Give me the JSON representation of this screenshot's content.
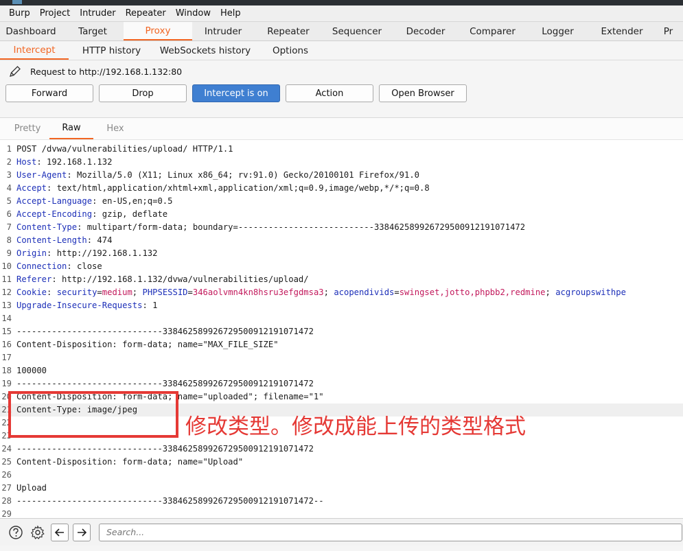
{
  "menubar": [
    "Burp",
    "Project",
    "Intruder",
    "Repeater",
    "Window",
    "Help"
  ],
  "main_tabs": [
    "Dashboard",
    "Target",
    "Proxy",
    "Intruder",
    "Repeater",
    "Sequencer",
    "Decoder",
    "Comparer",
    "Logger",
    "Extender",
    "Pr"
  ],
  "main_tabs_active": "Proxy",
  "proxy_tabs": [
    "Intercept",
    "HTTP history",
    "WebSockets history",
    "Options"
  ],
  "proxy_tabs_active": "Intercept",
  "request_label": "Request to http://192.168.1.132:80",
  "buttons": {
    "forward": "Forward",
    "drop": "Drop",
    "intercept": "Intercept is on",
    "action": "Action",
    "open_browser": "Open Browser"
  },
  "editor_tabs": [
    "Pretty",
    "Raw",
    "Hex"
  ],
  "editor_tabs_active": "Raw",
  "lines": [
    "POST /dvwa/vulnerabilities/upload/ HTTP/1.1",
    "Host: 192.168.1.132",
    "User-Agent: Mozilla/5.0 (X11; Linux x86_64; rv:91.0) Gecko/20100101 Firefox/91.0",
    "Accept: text/html,application/xhtml+xml,application/xml;q=0.9,image/webp,*/*;q=0.8",
    "Accept-Language: en-US,en;q=0.5",
    "Accept-Encoding: gzip, deflate",
    "Content-Type: multipart/form-data; boundary=---------------------------338462589926729500912191071472",
    "Content-Length: 474",
    "Origin: http://192.168.1.132",
    "Connection: close",
    "Referer: http://192.168.1.132/dvwa/vulnerabilities/upload/",
    "Cookie: security=medium; PHPSESSID=346aolvmn4kn8hsru3efgdmsa3; acopendivids=swingset,jotto,phpbb2,redmine; acgroupswithpe",
    "Upgrade-Insecure-Requests: 1",
    "",
    "-----------------------------338462589926729500912191071472",
    "Content-Disposition: form-data; name=\"MAX_FILE_SIZE\"",
    "",
    "100000",
    "-----------------------------338462589926729500912191071472",
    "Content-Disposition: form-data; name=\"uploaded\"; filename=\"1\"",
    "Content-Type: image/jpeg",
    "",
    "",
    "-----------------------------338462589926729500912191071472",
    "Content-Disposition: form-data; name=\"Upload\"",
    "",
    "Upload",
    "-----------------------------338462589926729500912191071472--",
    ""
  ],
  "highlight_line": 21,
  "header_line_count": 13,
  "annotation": "修改类型。修改成能上传的类型格式",
  "search_placeholder": "Search...",
  "colors": {
    "accent": "#f26522",
    "header_key": "#1c2fb8",
    "cookie_value": "#c2185b",
    "annotation_red": "#e53935",
    "intercept_button": "#3f7fd1"
  },
  "icons": [
    "help-icon",
    "settings-icon",
    "back-arrow-icon",
    "forward-arrow-icon",
    "pencil-icon"
  ]
}
